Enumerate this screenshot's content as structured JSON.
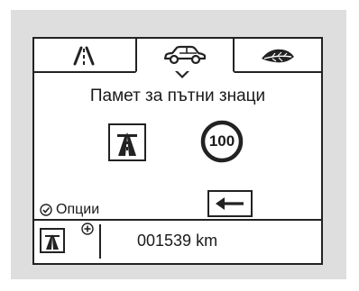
{
  "screen": {
    "tabs": [
      {
        "id": "road",
        "icon": "road-icon"
      },
      {
        "id": "car",
        "icon": "car-icon",
        "selected": true
      },
      {
        "id": "eco",
        "icon": "leaf-icon"
      }
    ],
    "title": "Памет за пътни знаци",
    "signs": {
      "motorway_icon": "motorway-sign-icon",
      "speed_limit": "100"
    },
    "options_label": "Опции",
    "back_icon": "left-arrow-icon",
    "status": {
      "odometer_value": "001539",
      "odometer_unit": "km",
      "odometer": "001539 km"
    }
  },
  "colors": {
    "bezel": "#dedede",
    "screen_bg": "#ffffff",
    "foreground": "#222222"
  }
}
